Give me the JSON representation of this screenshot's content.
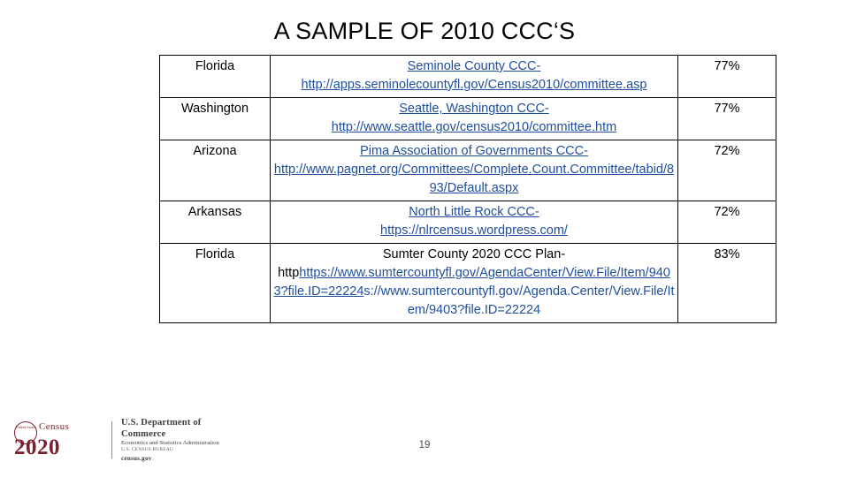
{
  "slide": {
    "title": "A SAMPLE OF 2010 CCC‘S",
    "page_number": "19"
  },
  "table": {
    "rows": [
      {
        "state": "Florida",
        "name": "Seminole County CCC-",
        "url": "http://apps.seminolecountyfl.gov/Census2010/committee.asp",
        "percent": "77%"
      },
      {
        "state": "Washington",
        "name": "Seattle, Washington CCC-",
        "url": "http://www.seattle.gov/census2010/committee.htm",
        "percent": "77%"
      },
      {
        "state": "Arizona",
        "name": "Pima Association of Governments CCC-",
        "url": "http://www.pagnet.org/Committees/Complete.Count.Committee/tabid/893/Default.aspx",
        "percent": "72%"
      },
      {
        "state": "Arkansas",
        "name": "North Little Rock CCC-",
        "url": "https://nlrcensus.wordpress.com/",
        "percent": "72%"
      },
      {
        "state": "Florida",
        "name": "Sumter County 2020 CCC Plan-",
        "url_prefix": "http",
        "url_link": "https://www.sumtercountyfl.gov/AgendaCenter/View.File/Item/9403?file.ID=22224",
        "url_suffix": "s://www.sumtercountyfl.gov/Agenda.Center/View.File/Item/9403?file.ID=22224",
        "percent": "83%"
      }
    ]
  },
  "footer_logo": {
    "seal_text": "United States",
    "census_word": "Census",
    "year_word": "2020",
    "dept_line1": "U.S. Department of Commerce",
    "dept_line2": "Economics and Statistics Administration",
    "dept_line3": "U.S. CENSUS BUREAU",
    "dept_line4": "census.gov"
  }
}
